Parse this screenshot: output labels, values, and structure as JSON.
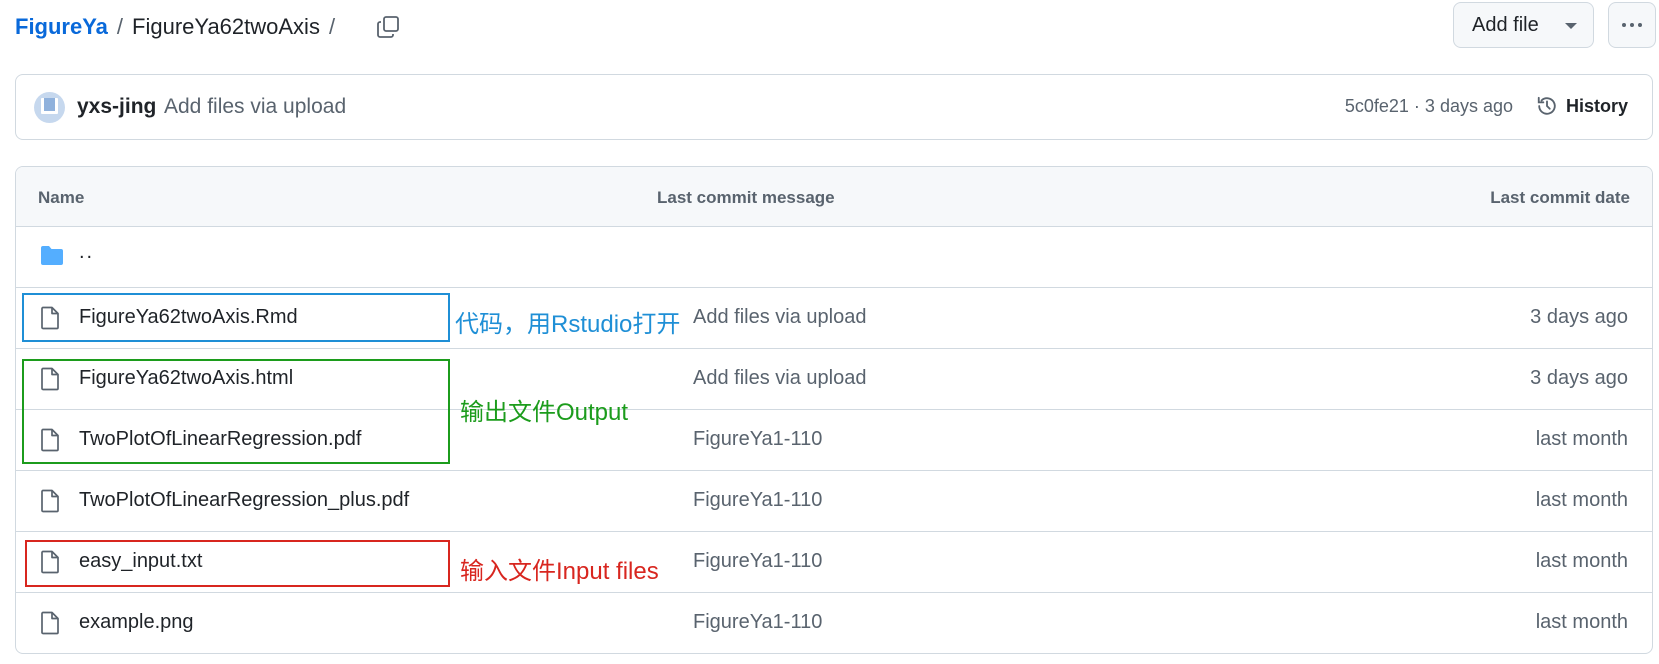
{
  "breadcrumb": {
    "repo": "FigureYa",
    "separator": "/",
    "current": "FigureYa62twoAxis",
    "trailing_separator": "/"
  },
  "header": {
    "copy_icon": "copy-path-icon",
    "add_file_label": "Add file",
    "more_icon": "kebab-horizontal-icon"
  },
  "commit": {
    "author": "yxs-jing",
    "message": "Add files via upload",
    "meta": "5c0fe21 · 3 days ago",
    "history_label": "History"
  },
  "table": {
    "columns": [
      "Name",
      "Last commit message",
      "Last commit date"
    ],
    "parent_label": "..",
    "rows": [
      {
        "name": "FigureYa62twoAxis.Rmd",
        "message": "Add files via upload",
        "date": "3 days ago"
      },
      {
        "name": "FigureYa62twoAxis.html",
        "message": "Add files via upload",
        "date": "3 days ago"
      },
      {
        "name": "TwoPlotOfLinearRegression.pdf",
        "message": "FigureYa1-110",
        "date": "last month"
      },
      {
        "name": "TwoPlotOfLinearRegression_plus.pdf",
        "message": "FigureYa1-110",
        "date": "last month"
      },
      {
        "name": "easy_input.txt",
        "message": "FigureYa1-110",
        "date": "last month"
      },
      {
        "name": "example.png",
        "message": "FigureYa1-110",
        "date": "last month"
      }
    ]
  },
  "annotations": {
    "code": {
      "text": "代码，用Rstudio打开",
      "color": "#1f8fd6"
    },
    "output": {
      "text": "输出文件Output",
      "color": "#1c9c1c"
    },
    "input": {
      "text": "输入文件Input files",
      "color": "#d8261f"
    }
  },
  "colors": {
    "link": "#0969da",
    "muted": "#59636e",
    "folder": "#54aeff",
    "border": "#d1d9e0"
  }
}
